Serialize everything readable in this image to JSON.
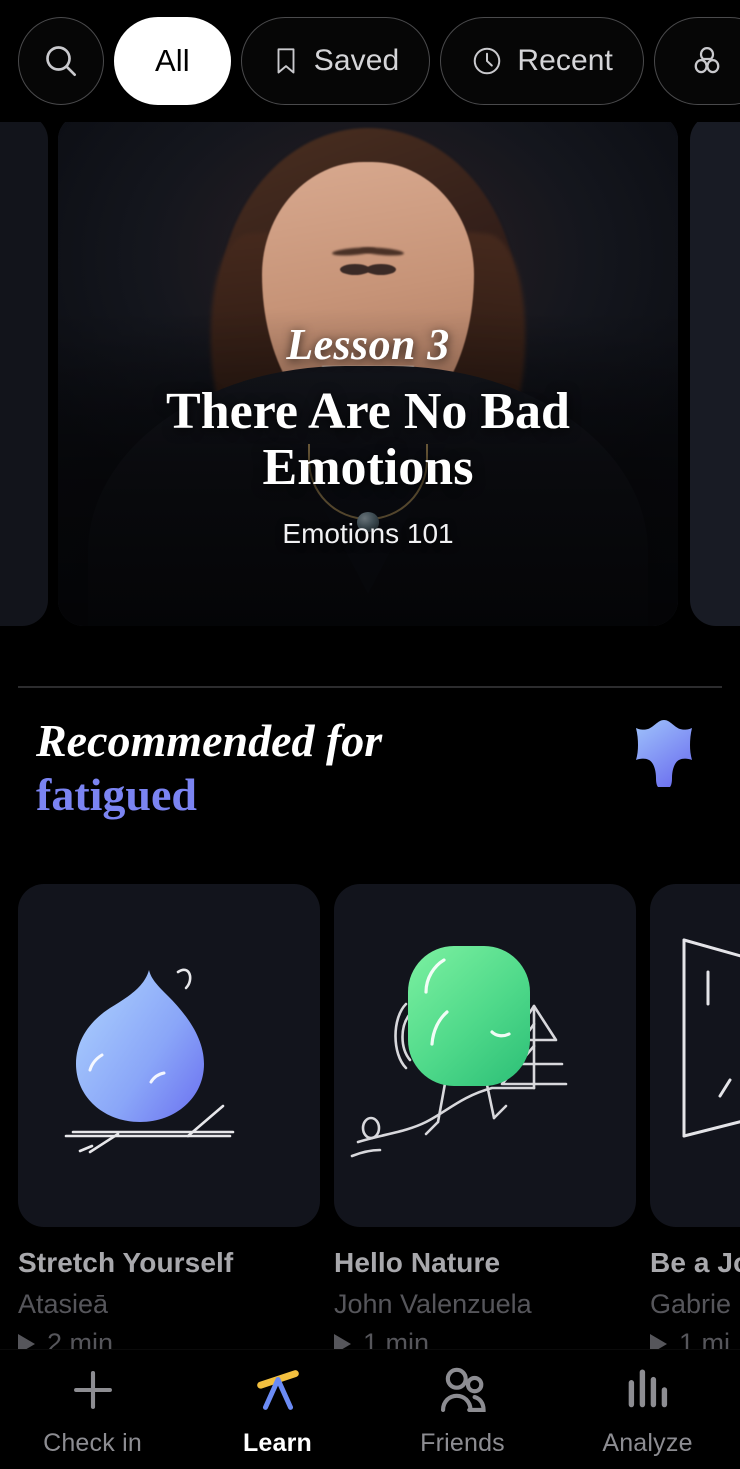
{
  "filter_bar": {
    "search": {
      "icon": "search-icon",
      "label": ""
    },
    "chips": [
      {
        "id": "all",
        "label": "All",
        "icon": null,
        "active": true
      },
      {
        "id": "saved",
        "label": "Saved",
        "icon": "bookmark-icon",
        "active": false
      },
      {
        "id": "recent",
        "label": "Recent",
        "icon": "clock-icon",
        "active": false
      },
      {
        "id": "mood",
        "label": "",
        "icon": "flower-icon",
        "active": false
      }
    ]
  },
  "hero": {
    "eyebrow": "Lesson 3",
    "title": "There Are No Bad Emotions",
    "subtitle": "Emotions 101"
  },
  "section": {
    "title_line1": "Recommended for",
    "title_line2": "fatigued",
    "mood_icon": "mood-blob-icon"
  },
  "recommendations": [
    {
      "title": "Stretch Yourself",
      "author": "Atasieā",
      "duration": "2 min",
      "art": "blue-droplet-stretching-icon"
    },
    {
      "title": "Hello Nature",
      "author": "John Valenzuela",
      "duration": "1 min",
      "art": "green-blob-hiking-icon"
    },
    {
      "title": "Be a Jo",
      "author": "Gabrie",
      "duration": "1 mi",
      "art": "yellow-sunburst-window-icon"
    }
  ],
  "bottom_nav": [
    {
      "id": "check-in",
      "label": "Check in",
      "icon": "plus-icon",
      "active": false
    },
    {
      "id": "learn",
      "label": "Learn",
      "icon": "telescope-icon",
      "active": true
    },
    {
      "id": "friends",
      "label": "Friends",
      "icon": "people-icon",
      "active": false
    },
    {
      "id": "analyze",
      "label": "Analyze",
      "icon": "bar-chart-icon",
      "active": false
    }
  ],
  "colors": {
    "background": "#000000",
    "card": "#12141c",
    "accent_blue": "#7b84f2",
    "accent_green": "#4fd98a",
    "accent_yellow": "#f5c43a",
    "text_primary": "#ffffff",
    "text_muted": "#56565b",
    "divider": "#2c2c2e"
  }
}
